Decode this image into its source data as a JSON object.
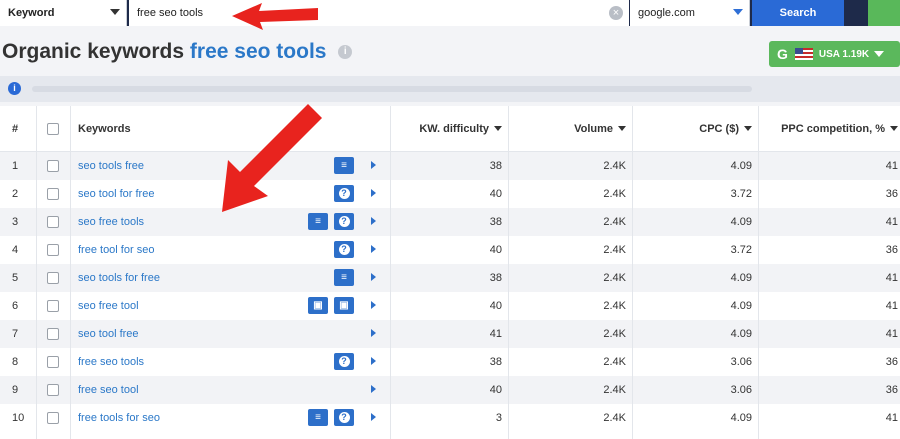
{
  "search": {
    "type_label": "Keyword",
    "query": "free seo tools",
    "clear_symbol": "×",
    "engine": "google.com",
    "button": "Search"
  },
  "heading": {
    "prefix": "Organic keywords",
    "query": "free seo tools",
    "info": "i"
  },
  "db_button": {
    "g": "G",
    "label": "USA 1.19K"
  },
  "info_strip": {
    "icon": "i"
  },
  "table": {
    "columns": [
      "#",
      "",
      "Keywords",
      "KW. difficulty",
      "Volume",
      "CPC ($)",
      "PPC competition, %"
    ],
    "rows": [
      {
        "num": "1",
        "keyword": "seo tools free",
        "features": [
          "list"
        ],
        "kd": "38",
        "volume": "2.4K",
        "cpc": "4.09",
        "ppc": "41"
      },
      {
        "num": "2",
        "keyword": "seo tool for free",
        "features": [
          "question"
        ],
        "kd": "40",
        "volume": "2.4K",
        "cpc": "3.72",
        "ppc": "36"
      },
      {
        "num": "3",
        "keyword": "seo free tools",
        "features": [
          "list",
          "question"
        ],
        "kd": "38",
        "volume": "2.4K",
        "cpc": "4.09",
        "ppc": "41"
      },
      {
        "num": "4",
        "keyword": "free tool for seo",
        "features": [
          "question"
        ],
        "kd": "40",
        "volume": "2.4K",
        "cpc": "3.72",
        "ppc": "36"
      },
      {
        "num": "5",
        "keyword": "seo tools for free",
        "features": [
          "list"
        ],
        "kd": "38",
        "volume": "2.4K",
        "cpc": "4.09",
        "ppc": "41"
      },
      {
        "num": "6",
        "keyword": "seo free tool",
        "features": [
          "image",
          "image"
        ],
        "kd": "40",
        "volume": "2.4K",
        "cpc": "4.09",
        "ppc": "41"
      },
      {
        "num": "7",
        "keyword": "seo tool free",
        "features": [],
        "kd": "41",
        "volume": "2.4K",
        "cpc": "4.09",
        "ppc": "41"
      },
      {
        "num": "8",
        "keyword": "free seo tools",
        "features": [
          "question"
        ],
        "kd": "38",
        "volume": "2.4K",
        "cpc": "3.06",
        "ppc": "36"
      },
      {
        "num": "9",
        "keyword": "free seo tool",
        "features": [],
        "kd": "40",
        "volume": "2.4K",
        "cpc": "3.06",
        "ppc": "36"
      },
      {
        "num": "10",
        "keyword": "free tools for seo",
        "features": [
          "list",
          "question"
        ],
        "kd": "3",
        "volume": "2.4K",
        "cpc": "4.09",
        "ppc": "41"
      }
    ]
  },
  "colors": {
    "nav": "#1e2a4a",
    "link": "#2b78c8",
    "accent_blue": "#2a6ad6",
    "green": "#5bb85c",
    "arrow_red": "#e8231e"
  }
}
